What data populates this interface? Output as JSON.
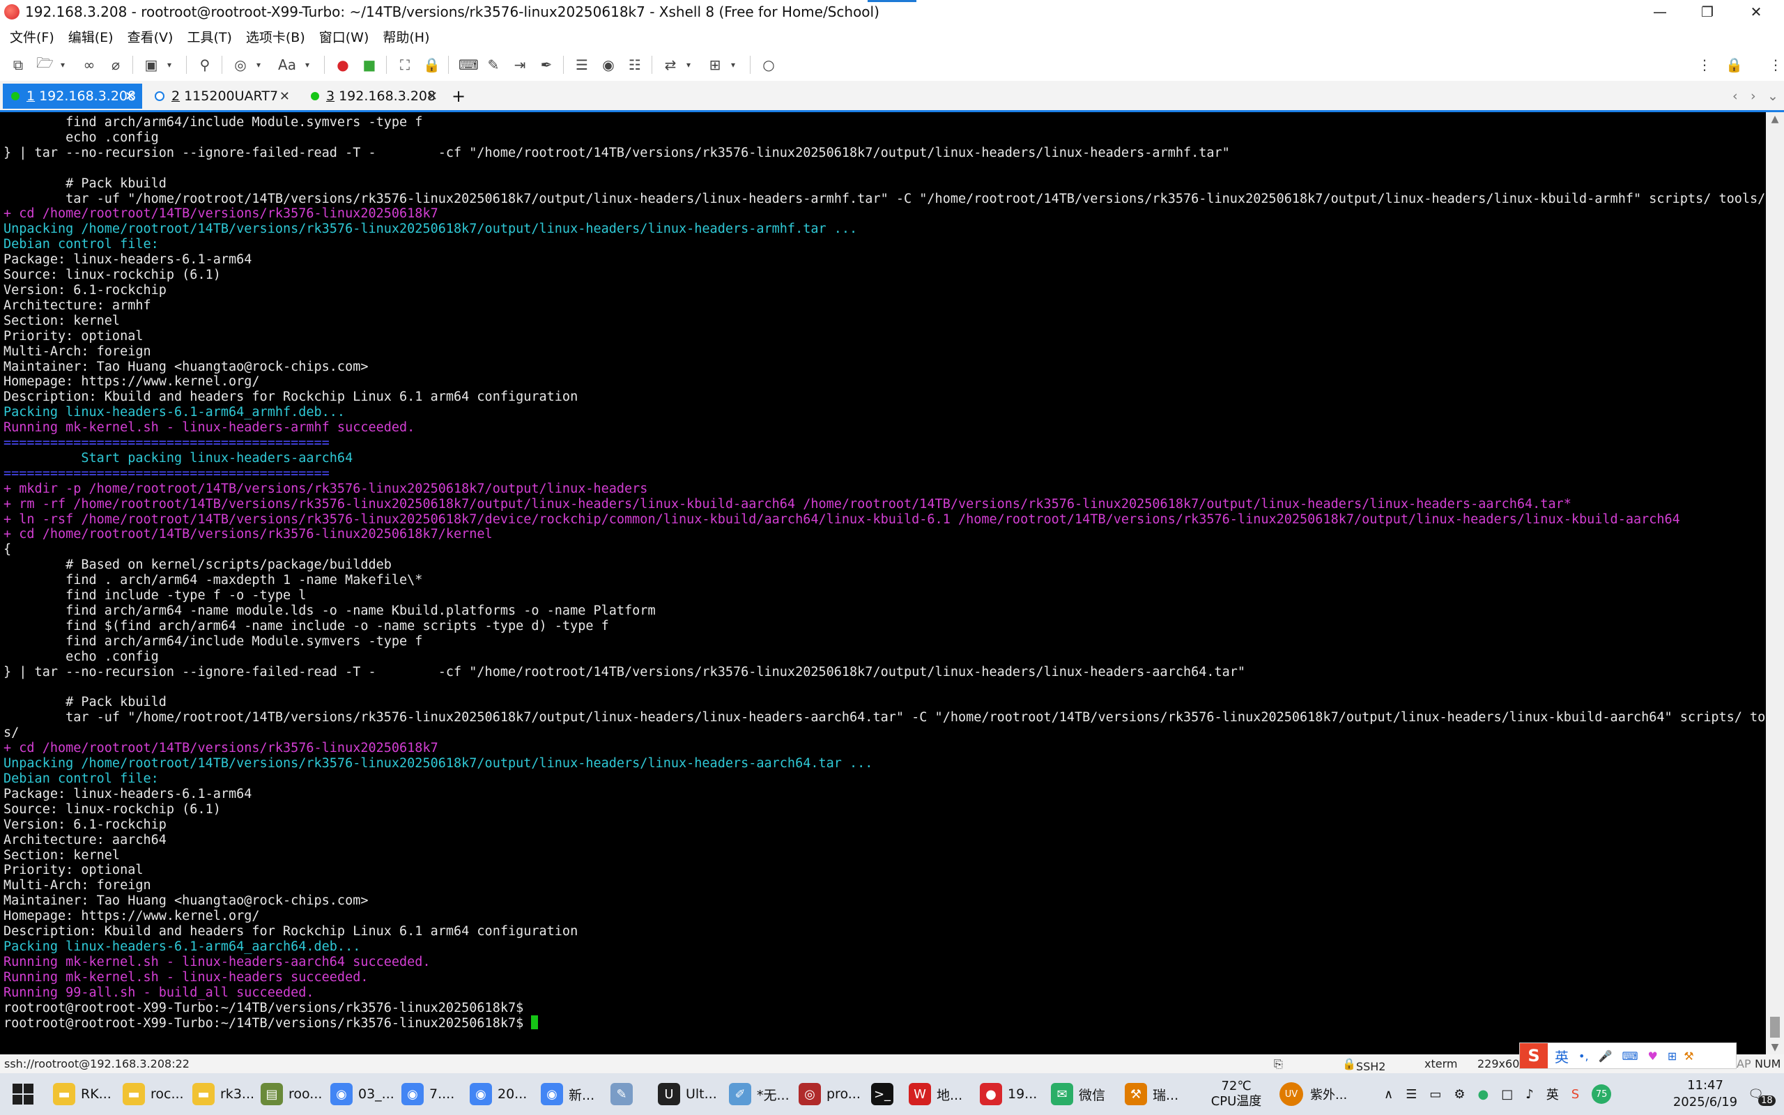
{
  "window": {
    "title": "192.168.3.208 - rootroot@rootroot-X99-Turbo: ~/14TB/versions/rk3576-linux20250618k7 - Xshell 8 (Free for Home/School)"
  },
  "menu": [
    "文件(F)",
    "编辑(E)",
    "查看(V)",
    "工具(T)",
    "选项卡(B)",
    "窗口(W)",
    "帮助(H)"
  ],
  "tabs": [
    {
      "number": "1",
      "label": "192.168.3.208",
      "active": true,
      "status_color": "#16c516"
    },
    {
      "number": "2",
      "label": "115200UART7",
      "active": false,
      "status_color": "#1a7ee6"
    },
    {
      "number": "3",
      "label": "192.168.3.208",
      "active": false,
      "status_color": "#16c516"
    }
  ],
  "colors": {
    "accent": "#1a7ee6",
    "terminal_bg": "#000000",
    "white": "#e8e8e8",
    "magenta": "#d43fd4",
    "cyan": "#2fc9d6",
    "blue": "#4b4bff",
    "cursor": "#16c516"
  },
  "terminal_lines": [
    {
      "c": "w",
      "t": "        find arch/arm64/include Module.symvers -type f"
    },
    {
      "c": "w",
      "t": "        echo .config"
    },
    {
      "c": "w",
      "t": "} | tar --no-recursion --ignore-failed-read -T -        -cf \"/home/rootroot/14TB/versions/rk3576-linux20250618k7/output/linux-headers/linux-headers-armhf.tar\""
    },
    {
      "c": "w",
      "t": ""
    },
    {
      "c": "w",
      "t": "        # Pack kbuild"
    },
    {
      "c": "w",
      "t": "        tar -uf \"/home/rootroot/14TB/versions/rk3576-linux20250618k7/output/linux-headers/linux-headers-armhf.tar\" -C \"/home/rootroot/14TB/versions/rk3576-linux20250618k7/output/linux-headers/linux-kbuild-armhf\" scripts/ tools/"
    },
    {
      "c": "m",
      "t": "+ cd /home/rootroot/14TB/versions/rk3576-linux20250618k7"
    },
    {
      "c": "c",
      "t": "Unpacking /home/rootroot/14TB/versions/rk3576-linux20250618k7/output/linux-headers/linux-headers-armhf.tar ..."
    },
    {
      "c": "c",
      "t": "Debian control file:"
    },
    {
      "c": "w",
      "t": "Package: linux-headers-6.1-arm64"
    },
    {
      "c": "w",
      "t": "Source: linux-rockchip (6.1)"
    },
    {
      "c": "w",
      "t": "Version: 6.1-rockchip"
    },
    {
      "c": "w",
      "t": "Architecture: armhf"
    },
    {
      "c": "w",
      "t": "Section: kernel"
    },
    {
      "c": "w",
      "t": "Priority: optional"
    },
    {
      "c": "w",
      "t": "Multi-Arch: foreign"
    },
    {
      "c": "w",
      "t": "Maintainer: Tao Huang <huangtao@rock-chips.com>"
    },
    {
      "c": "w",
      "t": "Homepage: https://www.kernel.org/"
    },
    {
      "c": "w",
      "t": "Description: Kbuild and headers for Rockchip Linux 6.1 arm64 configuration"
    },
    {
      "c": "c",
      "t": "Packing linux-headers-6.1-arm64_armhf.deb..."
    },
    {
      "c": "m",
      "t": "Running mk-kernel.sh - linux-headers-armhf succeeded."
    },
    {
      "c": "b",
      "t": "=========================================="
    },
    {
      "c": "c",
      "t": "          Start packing linux-headers-aarch64"
    },
    {
      "c": "b",
      "t": "=========================================="
    },
    {
      "c": "m",
      "t": "+ mkdir -p /home/rootroot/14TB/versions/rk3576-linux20250618k7/output/linux-headers"
    },
    {
      "c": "m",
      "t": "+ rm -rf /home/rootroot/14TB/versions/rk3576-linux20250618k7/output/linux-headers/linux-kbuild-aarch64 /home/rootroot/14TB/versions/rk3576-linux20250618k7/output/linux-headers/linux-headers-aarch64.tar*"
    },
    {
      "c": "m",
      "t": "+ ln -rsf /home/rootroot/14TB/versions/rk3576-linux20250618k7/device/rockchip/common/linux-kbuild/aarch64/linux-kbuild-6.1 /home/rootroot/14TB/versions/rk3576-linux20250618k7/output/linux-headers/linux-kbuild-aarch64"
    },
    {
      "c": "m",
      "t": "+ cd /home/rootroot/14TB/versions/rk3576-linux20250618k7/kernel"
    },
    {
      "c": "w",
      "t": "{"
    },
    {
      "c": "w",
      "t": "        # Based on kernel/scripts/package/builddeb"
    },
    {
      "c": "w",
      "t": "        find . arch/arm64 -maxdepth 1 -name Makefile\\*"
    },
    {
      "c": "w",
      "t": "        find include -type f -o -type l"
    },
    {
      "c": "w",
      "t": "        find arch/arm64 -name module.lds -o -name Kbuild.platforms -o -name Platform"
    },
    {
      "c": "w",
      "t": "        find $(find arch/arm64 -name include -o -name scripts -type d) -type f"
    },
    {
      "c": "w",
      "t": "        find arch/arm64/include Module.symvers -type f"
    },
    {
      "c": "w",
      "t": "        echo .config"
    },
    {
      "c": "w",
      "t": "} | tar --no-recursion --ignore-failed-read -T -        -cf \"/home/rootroot/14TB/versions/rk3576-linux20250618k7/output/linux-headers/linux-headers-aarch64.tar\""
    },
    {
      "c": "w",
      "t": ""
    },
    {
      "c": "w",
      "t": "        # Pack kbuild"
    },
    {
      "c": "w",
      "t": "        tar -uf \"/home/rootroot/14TB/versions/rk3576-linux20250618k7/output/linux-headers/linux-headers-aarch64.tar\" -C \"/home/rootroot/14TB/versions/rk3576-linux20250618k7/output/linux-headers/linux-kbuild-aarch64\" scripts/ tool"
    },
    {
      "c": "w",
      "t": "s/"
    },
    {
      "c": "m",
      "t": "+ cd /home/rootroot/14TB/versions/rk3576-linux20250618k7"
    },
    {
      "c": "c",
      "t": "Unpacking /home/rootroot/14TB/versions/rk3576-linux20250618k7/output/linux-headers/linux-headers-aarch64.tar ..."
    },
    {
      "c": "c",
      "t": "Debian control file:"
    },
    {
      "c": "w",
      "t": "Package: linux-headers-6.1-arm64"
    },
    {
      "c": "w",
      "t": "Source: linux-rockchip (6.1)"
    },
    {
      "c": "w",
      "t": "Version: 6.1-rockchip"
    },
    {
      "c": "w",
      "t": "Architecture: aarch64"
    },
    {
      "c": "w",
      "t": "Section: kernel"
    },
    {
      "c": "w",
      "t": "Priority: optional"
    },
    {
      "c": "w",
      "t": "Multi-Arch: foreign"
    },
    {
      "c": "w",
      "t": "Maintainer: Tao Huang <huangtao@rock-chips.com>"
    },
    {
      "c": "w",
      "t": "Homepage: https://www.kernel.org/"
    },
    {
      "c": "w",
      "t": "Description: Kbuild and headers for Rockchip Linux 6.1 arm64 configuration"
    },
    {
      "c": "c",
      "t": "Packing linux-headers-6.1-arm64_aarch64.deb..."
    },
    {
      "c": "m",
      "t": "Running mk-kernel.sh - linux-headers-aarch64 succeeded."
    },
    {
      "c": "m",
      "t": "Running mk-kernel.sh - linux-headers succeeded."
    },
    {
      "c": "m",
      "t": "Running 99-all.sh - build_all succeeded."
    },
    {
      "c": "w",
      "t": "rootroot@rootroot-X99-Turbo:~/14TB/versions/rk3576-linux20250618k7$"
    },
    {
      "c": "w",
      "t": "rootroot@rootroot-X99-Turbo:~/14TB/versions/rk3576-linux20250618k7$ ",
      "cursor": true
    }
  ],
  "status": {
    "connection": "ssh://rootroot@192.168.3.208:22",
    "protocol": "SSH2",
    "term": "xterm",
    "size": "229x60",
    "capsl": "AP",
    "num": "NUM"
  },
  "ime": {
    "lang": "英"
  },
  "taskbar": {
    "items": [
      {
        "label": "RK...",
        "icon": "folder-icon",
        "color": "#f1c232"
      },
      {
        "label": "roc...",
        "icon": "folder-icon",
        "color": "#f1c232"
      },
      {
        "label": "rk3...",
        "icon": "folder-icon",
        "color": "#f1c232"
      },
      {
        "label": "roo...",
        "icon": "file-icon",
        "color": "#6a8a3a"
      },
      {
        "label": "03_...",
        "icon": "chrome-icon",
        "color": "#4285f4"
      },
      {
        "label": "7....",
        "icon": "chrome-icon",
        "color": "#4285f4"
      },
      {
        "label": "20...",
        "icon": "chrome-icon",
        "color": "#4285f4"
      },
      {
        "label": "新...",
        "icon": "chrome-icon",
        "color": "#4285f4"
      },
      {
        "label": "",
        "icon": "paint-icon",
        "color": "#7a9cc6"
      },
      {
        "label": "Ult...",
        "icon": "ultraedit-icon",
        "color": "#222222"
      },
      {
        "label": "*无...",
        "icon": "notepad-icon",
        "color": "#5b9bd5"
      },
      {
        "label": "pro...",
        "icon": "app-icon",
        "color": "#b02a2a"
      },
      {
        "label": "",
        "icon": "terminal-icon",
        "color": "#111111"
      },
      {
        "label": "地...",
        "icon": "wps-icon",
        "color": "#d42020"
      },
      {
        "label": "19...",
        "icon": "xshell-icon",
        "color": "#d9262b"
      },
      {
        "label": "微信",
        "icon": "wechat-icon",
        "color": "#2aae67"
      },
      {
        "label": "瑞...",
        "icon": "tool-icon",
        "color": "#e07b00"
      }
    ],
    "temp": "72℃",
    "temp_label": "CPU温度",
    "weather": "紫外...",
    "weather_badge": "UV",
    "badge_number": "75",
    "time": "11:47",
    "date": "2025/6/19",
    "notifications": "18"
  }
}
